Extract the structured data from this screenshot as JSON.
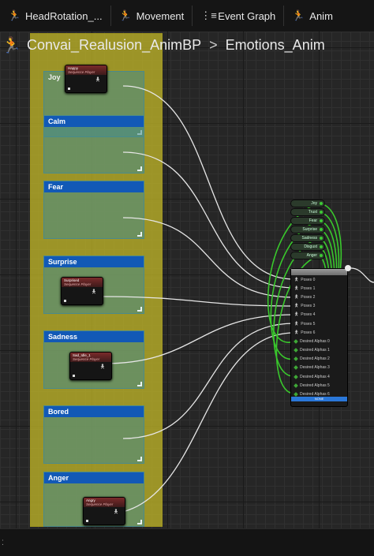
{
  "tabs": [
    {
      "label": "HeadRotation_...",
      "icon": "running-figure-icon"
    },
    {
      "label": "Movement",
      "icon": "running-figure-icon"
    },
    {
      "label": "Event Graph",
      "icon": "event-graph-icon"
    },
    {
      "label": "Anim",
      "icon": "running-figure-icon"
    }
  ],
  "breadcrumb": {
    "blueprint": "Convai_Realusion_AnimBP",
    "separator": ">",
    "graph": "Emotions_Anim"
  },
  "comments": [
    {
      "title": "Joy"
    },
    {
      "title": "Calm"
    },
    {
      "title": "Fear"
    },
    {
      "title": "Surprise"
    },
    {
      "title": "Sadness"
    },
    {
      "title": "Bored"
    },
    {
      "title": "Anger"
    }
  ],
  "players": [
    {
      "name": "Happy",
      "type": "Sequence Player"
    },
    {
      "name": "Surprised",
      "type": "Sequence Player"
    },
    {
      "name": "Sad_Idle_1",
      "type": "Sequence Player"
    },
    {
      "name": "Angry",
      "type": "Sequence Player"
    }
  ],
  "getters": [
    "Joy",
    "Trust",
    "Fear",
    "Surprise",
    "Sadness",
    "Disgust",
    "Anger"
  ],
  "blend_node": {
    "poses": [
      "Poses 0",
      "Poses 1",
      "Poses 2",
      "Poses 3",
      "Poses 4",
      "Poses 5",
      "Poses 6"
    ],
    "alphas": [
      "Desired Alphas 0",
      "Desired Alphas 1",
      "Desired Alphas 2",
      "Desired Alphas 3",
      "Desired Alphas 4",
      "Desired Alphas 5",
      "Desired Alphas 6"
    ],
    "footer": "NONE"
  },
  "colors": {
    "wire": "#e6e6e6",
    "float_wire": "#39c82c",
    "comment_outer": "#c2b82a",
    "comment_header": "#1259b6"
  }
}
